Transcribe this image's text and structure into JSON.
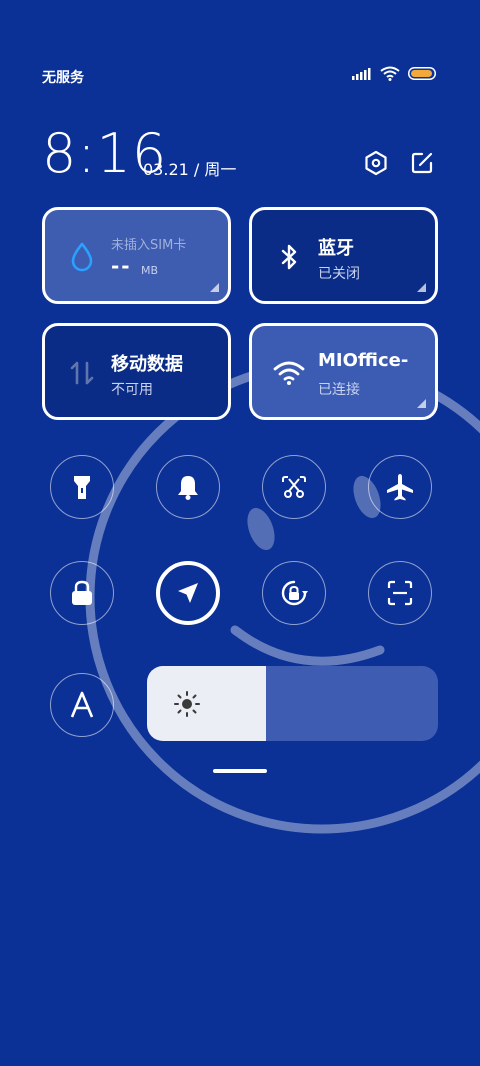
{
  "status_bar": {
    "carrier": "无服务",
    "signal_icon": "signal-bars-icon",
    "wifi_icon": "wifi-icon",
    "battery_icon": "battery-icon"
  },
  "header": {
    "time": "8:16",
    "date": "03.21 / 周一",
    "settings_icon": "settings-hexagon-icon",
    "edit_icon": "edit-icon"
  },
  "tiles": {
    "data_usage": {
      "label": "未插入SIM卡",
      "value": "--",
      "unit": "MB",
      "icon": "water-drop-icon"
    },
    "bluetooth": {
      "title": "蓝牙",
      "status": "已关闭",
      "icon": "bluetooth-icon"
    },
    "mobile_data": {
      "title": "移动数据",
      "status": "不可用",
      "icon": "data-arrows-icon"
    },
    "wifi": {
      "title": "MIOffice-",
      "status": "已连接",
      "icon": "wifi-icon"
    }
  },
  "toggles": [
    {
      "name": "flashlight",
      "icon": "flashlight-icon",
      "active": false
    },
    {
      "name": "silent",
      "icon": "bell-icon",
      "active": false
    },
    {
      "name": "screenshot",
      "icon": "scissors-screenshot-icon",
      "active": false
    },
    {
      "name": "airplane-mode",
      "icon": "airplane-icon",
      "active": false
    },
    {
      "name": "lock-screen",
      "icon": "lock-icon",
      "active": false
    },
    {
      "name": "location",
      "icon": "location-arrow-icon",
      "active": true
    },
    {
      "name": "rotation-lock",
      "icon": "rotation-lock-icon",
      "active": false
    },
    {
      "name": "scanner",
      "icon": "scan-icon",
      "active": false
    },
    {
      "name": "auto-brightness",
      "icon": "letter-a-icon",
      "active": false
    }
  ],
  "brightness": {
    "level": 0.41,
    "icon": "sun-icon"
  },
  "colors": {
    "background": "#0b3096",
    "tile_off": "#0b2c86",
    "tile_on": "#3c5cb4",
    "accent_blue": "#2aa0ff"
  }
}
